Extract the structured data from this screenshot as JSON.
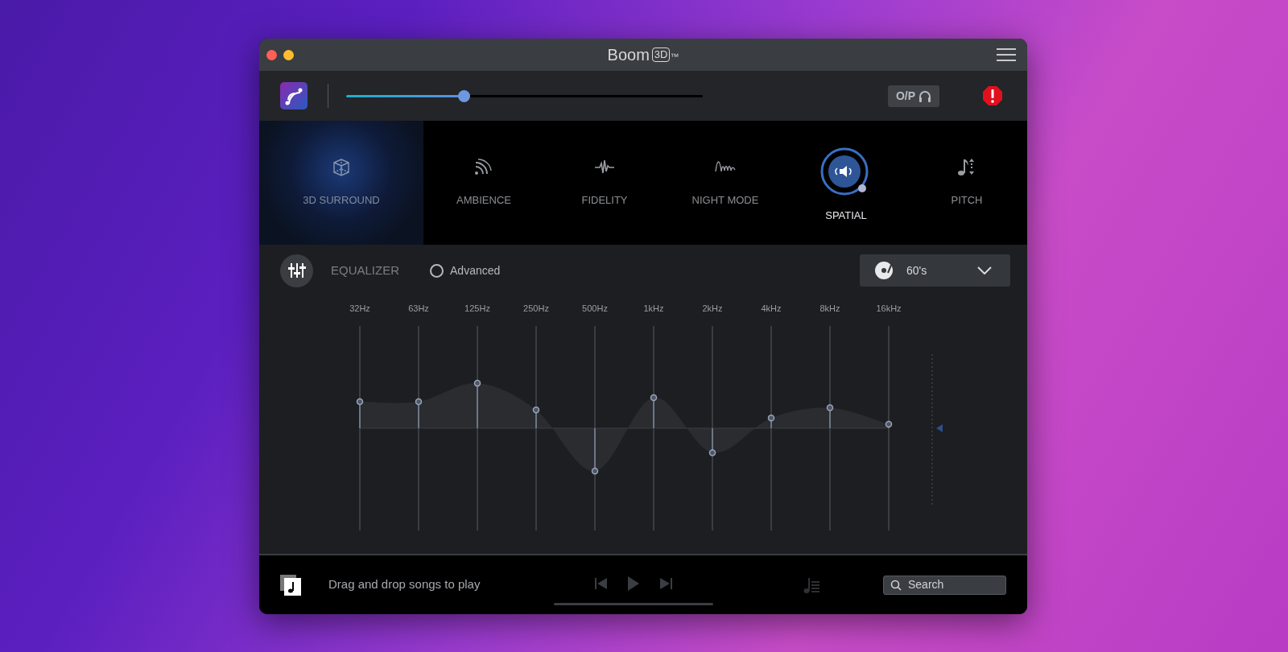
{
  "window": {
    "title": "Boom",
    "title_badge": "3D",
    "title_mark": "™"
  },
  "toolbar": {
    "volume": {
      "level": 0.33
    },
    "output_button": "O/P"
  },
  "effects": [
    {
      "label": "3D SURROUND",
      "kind": "surround",
      "selected": true,
      "on": false
    },
    {
      "label": "AMBIENCE",
      "kind": "ambience",
      "selected": false,
      "on": false
    },
    {
      "label": "FIDELITY",
      "kind": "fidelity",
      "selected": false,
      "on": false
    },
    {
      "label": "NIGHT MODE",
      "kind": "night",
      "selected": false,
      "on": false
    },
    {
      "label": "SPATIAL",
      "kind": "spatial",
      "selected": false,
      "on": true
    },
    {
      "label": "PITCH",
      "kind": "pitch",
      "selected": false,
      "on": false
    }
  ],
  "equalizer": {
    "title": "EQUALIZER",
    "advanced": {
      "label": "Advanced",
      "checked": false
    },
    "preset": "60's",
    "bands": [
      {
        "label": "32Hz",
        "level": 0.63
      },
      {
        "label": "63Hz",
        "level": 0.63
      },
      {
        "label": "125Hz",
        "level": 0.72
      },
      {
        "label": "250Hz",
        "level": 0.59
      },
      {
        "label": "500Hz",
        "level": 0.29
      },
      {
        "label": "1kHz",
        "level": 0.65
      },
      {
        "label": "2kHz",
        "level": 0.38
      },
      {
        "label": "4kHz",
        "level": 0.55
      },
      {
        "label": "8kHz",
        "level": 0.6
      },
      {
        "label": "16kHz",
        "level": 0.52
      }
    ]
  },
  "player": {
    "hint": "Drag and drop songs to play",
    "progress": {
      "level": 0
    },
    "search": {
      "placeholder": "Search"
    }
  }
}
